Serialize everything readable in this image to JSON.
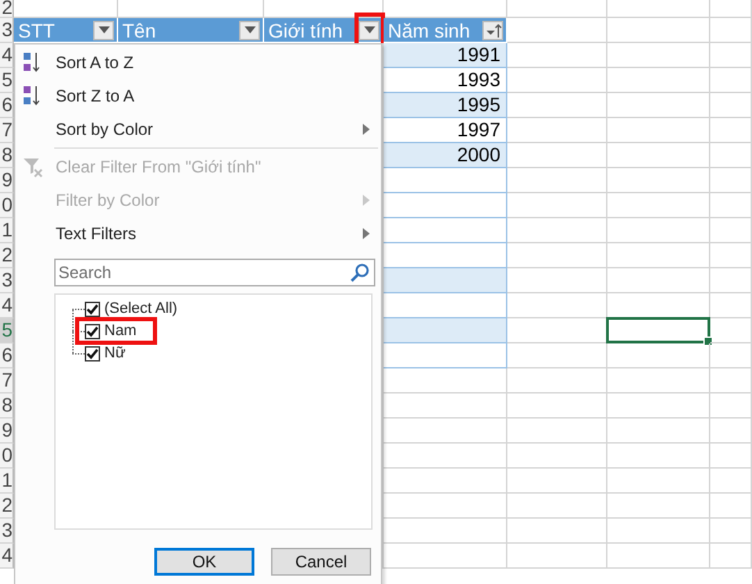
{
  "row_numbers": [
    {
      "label": "2",
      "selected": false
    },
    {
      "label": "3",
      "selected": false
    },
    {
      "label": "4",
      "selected": false
    },
    {
      "label": "5",
      "selected": false
    },
    {
      "label": "6",
      "selected": false
    },
    {
      "label": "7",
      "selected": false
    },
    {
      "label": "8",
      "selected": false
    },
    {
      "label": "9",
      "selected": false
    },
    {
      "label": "0",
      "selected": false
    },
    {
      "label": "1",
      "selected": false
    },
    {
      "label": "2",
      "selected": false
    },
    {
      "label": "3",
      "selected": false
    },
    {
      "label": "4",
      "selected": false
    },
    {
      "label": "5",
      "selected": true
    },
    {
      "label": "6",
      "selected": false
    },
    {
      "label": "7",
      "selected": false
    },
    {
      "label": "8",
      "selected": false
    },
    {
      "label": "9",
      "selected": false
    },
    {
      "label": "0",
      "selected": false
    },
    {
      "label": "1",
      "selected": false
    },
    {
      "label": "2",
      "selected": false
    },
    {
      "label": "3",
      "selected": false
    },
    {
      "label": "4",
      "selected": false
    }
  ],
  "table": {
    "columns": [
      {
        "label": "STT",
        "sorted": false,
        "highlighted": false
      },
      {
        "label": "Tên",
        "sorted": false,
        "highlighted": false
      },
      {
        "label": "Giới tính",
        "sorted": false,
        "highlighted": true
      },
      {
        "label": "Năm sinh",
        "sorted": true,
        "highlighted": false
      }
    ],
    "rows": [
      {
        "nam_sinh": "1991",
        "shaded": true
      },
      {
        "nam_sinh": "1993",
        "shaded": false
      },
      {
        "nam_sinh": "1995",
        "shaded": true
      },
      {
        "nam_sinh": "1997",
        "shaded": false
      },
      {
        "nam_sinh": "2000",
        "shaded": true
      },
      {
        "shaded": false
      },
      {
        "shaded": false
      },
      {
        "shaded": false
      },
      {
        "shaded": false
      },
      {
        "shaded": true
      },
      {
        "shaded": false
      },
      {
        "shaded": true
      },
      {
        "shaded": false
      }
    ]
  },
  "filter_menu": {
    "items": [
      {
        "kind": "sort_asc",
        "label": "Sort A to Z",
        "disabled": false,
        "submenu": false
      },
      {
        "kind": "sort_desc",
        "label": "Sort Z to A",
        "disabled": false,
        "submenu": false
      },
      {
        "kind": "plain",
        "label": "Sort by Color",
        "disabled": false,
        "submenu": true
      },
      {
        "kind": "separator"
      },
      {
        "kind": "clear",
        "label": "Clear Filter From \"Giới tính\"",
        "disabled": true,
        "submenu": false
      },
      {
        "kind": "plain",
        "label": "Filter by Color",
        "disabled": true,
        "submenu": true
      },
      {
        "kind": "plain",
        "label": "Text Filters",
        "disabled": false,
        "submenu": true
      }
    ],
    "search": {
      "placeholder": "Search"
    },
    "values": [
      {
        "label": "(Select All)",
        "checked": true,
        "highlighted": false,
        "children": [
          {
            "label": "Nam",
            "checked": true,
            "highlighted": true
          },
          {
            "label": "Nữ",
            "checked": true,
            "highlighted": false
          }
        ]
      }
    ],
    "buttons": [
      {
        "label": "OK",
        "default": true
      },
      {
        "label": "Cancel",
        "default": false
      }
    ]
  }
}
